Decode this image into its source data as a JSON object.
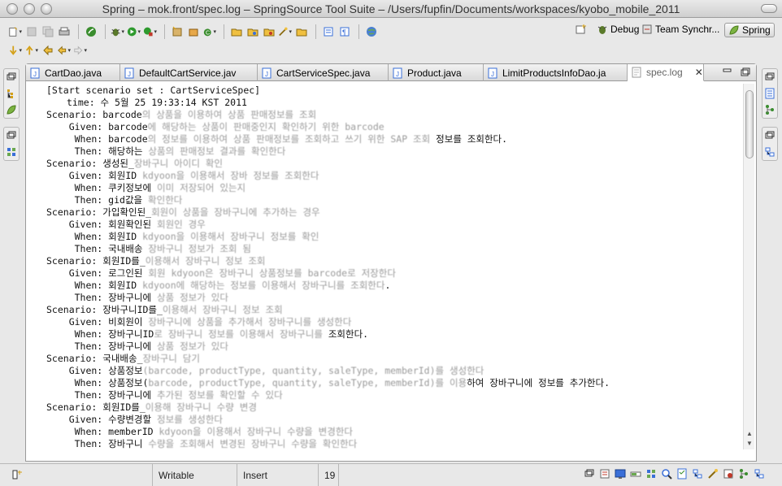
{
  "window": {
    "title": "Spring – mok.front/spec.log – SpringSource Tool Suite – /Users/fupfin/Documents/workspaces/kyobo_mobile_2011"
  },
  "perspectives": {
    "debug": "Debug",
    "team": "Team Synchr...",
    "spring": "Spring"
  },
  "tabs": [
    {
      "label": "CartDao.java"
    },
    {
      "label": "DefaultCartService.jav"
    },
    {
      "label": "CartServiceSpec.java"
    },
    {
      "label": "Product.java"
    },
    {
      "label": "LimitProductsInfoDao.ja"
    },
    {
      "label": "spec.log"
    }
  ],
  "log": {
    "header": "[Start scenario set : CartServiceSpec]",
    "time": "time: 수 5월 25 19:33:14 KST 2011",
    "lines": [
      {
        "kw": "Scenario:",
        "text": "barcode",
        "blur": "의 상품을 이용하여 상품 판매정보를 조회"
      },
      {
        "kw": "Given:",
        "text": "barcode",
        "blur": "에 해당하는 상품이 판매중인지 확인하기 위한 barcode"
      },
      {
        "kw": "When:",
        "text": "barcode",
        "blur": "의 정보를 이용하여 상품 판매정보를 조회하고 쓰기 위한 SAP 조회",
        "tail": " 정보를 조회한다."
      },
      {
        "kw": "Then:",
        "text": "해당하는 ",
        "blur": "상품의 판매정보 결과를 확인한다"
      },
      {
        "kw": "Scenario:",
        "text": "생성된_",
        "blur": "장바구니 아이디 확인"
      },
      {
        "kw": "Given:",
        "text": "회원ID ",
        "blur": "kdyoon을 이용해서 장바 정보를 조회한다"
      },
      {
        "kw": "When:",
        "text": "쿠키정보에 ",
        "blur": "이미 저장되어 있는지"
      },
      {
        "kw": "Then:",
        "text": "gid값을 ",
        "blur": "확인한다"
      },
      {
        "kw": "Scenario:",
        "text": "가입확인된_",
        "blur": "회원이 상품을 장바구니에 추가하는 경우"
      },
      {
        "kw": "Given:",
        "text": "회원확인된 ",
        "blur": "회원인 경우"
      },
      {
        "kw": "When:",
        "text": "회원ID ",
        "blur": "kdyoon을 이용해서 장바구니 정보를 확인"
      },
      {
        "kw": "Then:",
        "text": "국내배송 ",
        "blur": "장바구니 정보가 조회 됨"
      },
      {
        "kw": "Scenario:",
        "text": "회원ID를_",
        "blur": "이용해서 장바구니 정보 조회"
      },
      {
        "kw": "Given:",
        "text": "로그인된 ",
        "blur": "회원 kdyoon은 장바구니 상품정보를 barcode로 저장한다"
      },
      {
        "kw": "When:",
        "text": "회원ID ",
        "blur": "kdyoon에 해당하는 정보를 이용해서 장바구니를 조회한다",
        "tail": "."
      },
      {
        "kw": "Then:",
        "text": "장바구니에 ",
        "blur": "상품 정보가 있다"
      },
      {
        "kw": "Scenario:",
        "text": "장바구니ID를_",
        "blur": "이용해서 장바구니 정보 조회"
      },
      {
        "kw": "Given:",
        "text": "비회원이 ",
        "blur": "장바구니에 상품을 추가해서 장바구니를 생성한다"
      },
      {
        "kw": "When:",
        "text": "장바구니ID",
        "blur": "로 장바구니 정보를 이용해서 장바구니를",
        "tail": " 조회한다."
      },
      {
        "kw": "Then:",
        "text": "장바구니에 ",
        "blur": "상품 정보가 있다"
      },
      {
        "kw": "Scenario:",
        "text": "국내배송_",
        "blur": "장바구니 담기"
      },
      {
        "kw": "Given:",
        "text": "상품정보",
        "blur": "(barcode, productType, quantity, saleType, memberId)를 생성한다"
      },
      {
        "kw": "When:",
        "text": "상품정보(",
        "blur": "barcode, productType, quantity, saleType, memberId)를 이용",
        "tail": "하여 장바구니에 정보를 추가한다."
      },
      {
        "kw": "Then:",
        "text": "장바구니에 ",
        "blur": "추가된 정보를 확인할 수 있다"
      },
      {
        "kw": "Scenario:",
        "text": "회원ID를_",
        "blur": "이용해 장바구니 수량 변경"
      },
      {
        "kw": "Given:",
        "text": "수량변경할 ",
        "blur": "정보를 생성한다"
      },
      {
        "kw": "When:",
        "text": "memberID ",
        "blur": "kdyoon을 이용해서 장바구니 수량을 변경한다"
      },
      {
        "kw": "Then:",
        "text": "장바구니 ",
        "blur": "수량을 조회해서 변경된 장바구니 수량을 확인한다"
      }
    ]
  },
  "statusbar": {
    "writable": "Writable",
    "insert": "Insert",
    "position": "19"
  }
}
